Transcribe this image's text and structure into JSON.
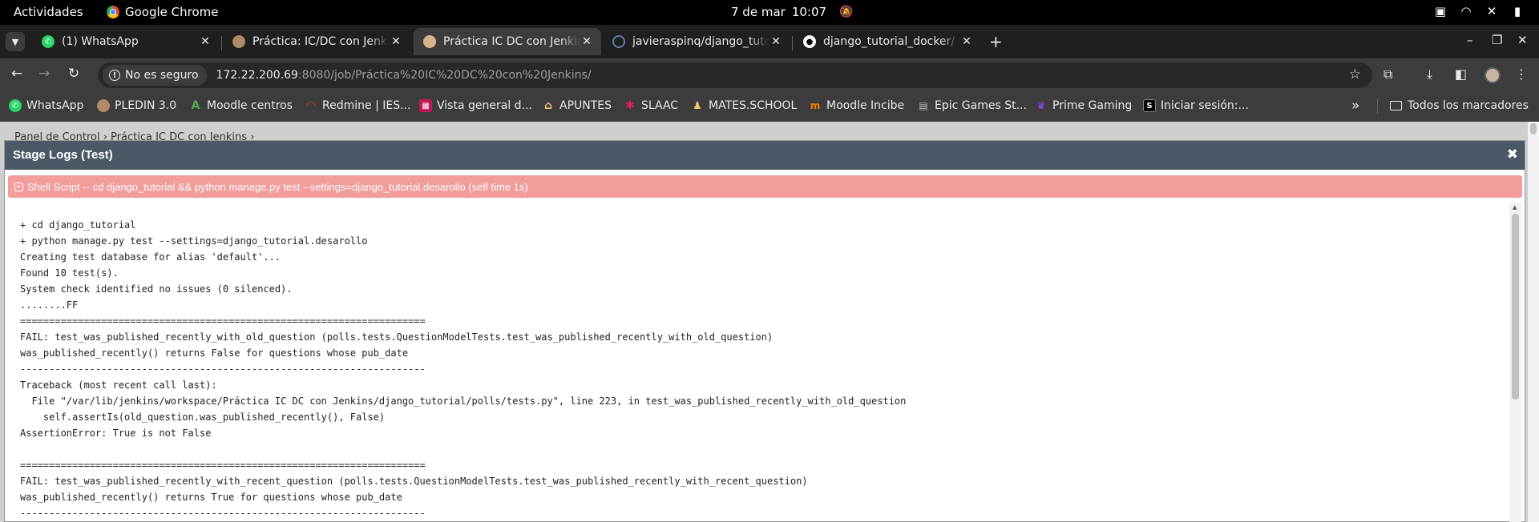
{
  "gnome": {
    "activities": "Actividades",
    "app_name": "Google Chrome",
    "date": "7 de mar",
    "time": "10:07"
  },
  "tabs": [
    {
      "title": "(1) WhatsApp",
      "favicon": "whatsapp-icon",
      "color": "#25d366",
      "active": false
    },
    {
      "title": "Práctica: IC/DC con Jenkins",
      "favicon": "pledin-avatar-icon",
      "color": "#b08968",
      "active": false
    },
    {
      "title": "Práctica IC DC con Jenkins",
      "favicon": "jenkins-icon",
      "color": "#d9b38c",
      "active": true
    },
    {
      "title": "javieraspinq/django_tuto",
      "favicon": "eclipse-icon",
      "color": "#5b7fa6",
      "active": false
    },
    {
      "title": "django_tutorial_docker/",
      "favicon": "github-icon",
      "color": "#ffffff",
      "active": false
    }
  ],
  "toolbar": {
    "security_chip": "No es seguro",
    "url_host": "172.22.200.69",
    "url_rest": ":8080/job/Pr%C3%A1ctica%20IC%20DC%20con%20Jenkins/",
    "url_display": ":8080/job/Práctica%20IC%20DC%20con%20Jenkins/"
  },
  "bookmarks": [
    {
      "label": "WhatsApp",
      "icon": "whatsapp-icon",
      "color": "#25d366"
    },
    {
      "label": "PLEDIN 3.0",
      "icon": "pledin-icon",
      "color": "#b08968"
    },
    {
      "label": "Moodle centros",
      "icon": "moodle-icon",
      "color": "#2e7d32"
    },
    {
      "label": "Redmine | IES...",
      "icon": "redmine-icon",
      "color": "#b71c1c"
    },
    {
      "label": "Vista general d...",
      "icon": "gitlab-icon",
      "color": "#c2185b"
    },
    {
      "label": "APUNTES",
      "icon": "home-icon",
      "color": "#f5c26b"
    },
    {
      "label": "SLAAC",
      "icon": "slack-icon",
      "color": "#e01e5a"
    },
    {
      "label": "MATES.SCHOOL",
      "icon": "mates-icon",
      "color": "#f5c26b"
    },
    {
      "label": "Moodle Incibe",
      "icon": "moodle-incibe-icon",
      "color": "#f57c00"
    },
    {
      "label": "Epic Games St...",
      "icon": "epic-icon",
      "color": "#555555"
    },
    {
      "label": "Prime Gaming",
      "icon": "crown-icon",
      "color": "#9146ff"
    },
    {
      "label": "Iniciar sesión:...",
      "icon": "s-icon",
      "color": "#000000"
    }
  ],
  "bookmarks_all": "Todos los marcadores",
  "page": {
    "breadcrumb": "Panel de Control › Práctica IC DC con Jenkins ›"
  },
  "modal": {
    "title": "Stage Logs (Test)",
    "step": "Shell Script -- cd django_tutorial && python manage.py test --settings=django_tutorial.desarollo (self time 1s)",
    "log_lines": [
      "+ cd django_tutorial",
      "+ python manage.py test --settings=django_tutorial.desarollo",
      "Creating test database for alias 'default'...",
      "Found 10 test(s).",
      "System check identified no issues (0 silenced).",
      "........FF",
      "======================================================================",
      "FAIL: test_was_published_recently_with_old_question (polls.tests.QuestionModelTests.test_was_published_recently_with_old_question)",
      "was_published_recently() returns False for questions whose pub_date",
      "----------------------------------------------------------------------",
      "Traceback (most recent call last):",
      "  File \"/var/lib/jenkins/workspace/Práctica IC DC con Jenkins/django_tutorial/polls/tests.py\", line 223, in test_was_published_recently_with_old_question",
      "    self.assertIs(old_question.was_published_recently(), False)",
      "AssertionError: True is not False",
      "",
      "======================================================================",
      "FAIL: test_was_published_recently_with_recent_question (polls.tests.QuestionModelTests.test_was_published_recently_with_recent_question)",
      "was_published_recently() returns True for questions whose pub_date",
      "----------------------------------------------------------------------"
    ]
  },
  "colors": {
    "modal_header": "#4b5966",
    "step_bar_failed": "#f29c9c"
  }
}
